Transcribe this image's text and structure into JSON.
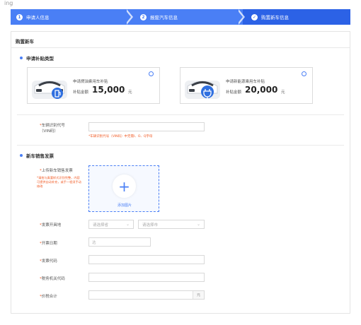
{
  "top_strip_text": "ing",
  "steps": [
    {
      "num": "1",
      "label": "申请人信息"
    },
    {
      "num": "2",
      "label": "报废汽车信息"
    },
    {
      "num": "✓",
      "label": "购置新车信息"
    }
  ],
  "panel": {
    "title": "购置新车"
  },
  "subsidy": {
    "heading": "申请补贴类型",
    "cards": [
      {
        "name": "申请燃油乘用车补贴",
        "amount_label": "补贴金额",
        "amount": "15,000",
        "unit": "元",
        "icon": "fuel-car-icon",
        "accent": "#2f6fe0"
      },
      {
        "name": "申请新能源乘用车补贴",
        "amount_label": "补贴金额",
        "amount": "20,000",
        "unit": "元",
        "icon": "ev-car-icon",
        "accent": "#2f6fe0"
      }
    ]
  },
  "vin": {
    "label_line1": "车辆识别代号",
    "label_line2": "（VIN码）",
    "value": "",
    "hint": "*车辆识别代号（VIN码）中无需I、O、Q字母"
  },
  "invoice": {
    "heading": "新车销售发票",
    "upload_label": "上传新车销售发票",
    "upload_hint": "*请拍与真要样式识别完整，内容可提供自动补充，或手一程须手动修改",
    "upload_caption": "添加图片",
    "issue_place_label": "发票开具地",
    "province_placeholder": "请选择省",
    "city_placeholder": "请选择市",
    "date_label": "开票日期",
    "date_placeholder": "选",
    "code_label": "发票代码",
    "tax_label": "税务机关代码",
    "total_label": "价税合计",
    "total_unit": "元"
  },
  "colors": {
    "primary": "#4a7ff5",
    "required": "#f15a24"
  }
}
